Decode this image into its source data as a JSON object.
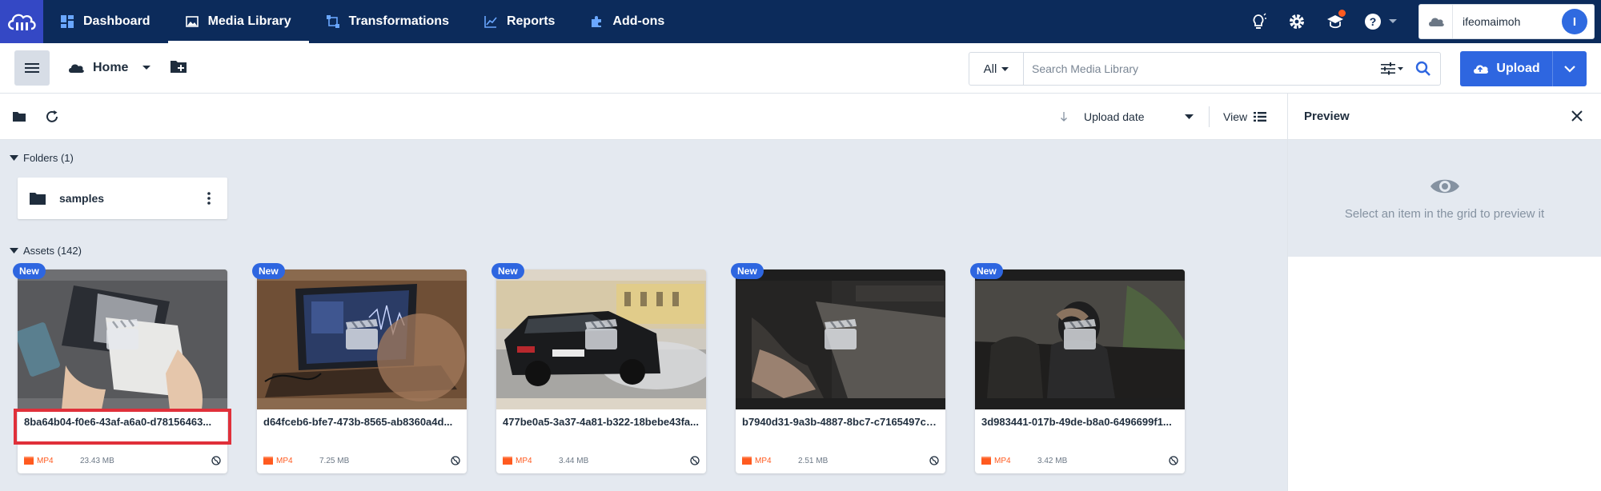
{
  "nav": {
    "items": [
      {
        "label": "Dashboard",
        "icon": "dashboard-icon"
      },
      {
        "label": "Media Library",
        "icon": "media-library-icon",
        "active": true
      },
      {
        "label": "Transformations",
        "icon": "transformations-icon"
      },
      {
        "label": "Reports",
        "icon": "reports-icon"
      },
      {
        "label": "Add-ons",
        "icon": "addons-icon"
      }
    ],
    "account_name": "ifeomaimoh",
    "avatar_initial": "I"
  },
  "toolbar": {
    "breadcrumb_home": "Home",
    "search_filter": "All",
    "search_placeholder": "Search Media Library",
    "upload_label": "Upload"
  },
  "subbar": {
    "sort_label": "Upload date",
    "view_label": "View"
  },
  "folders": {
    "header": "Folders (1)",
    "items": [
      {
        "name": "samples"
      }
    ]
  },
  "assets": {
    "header": "Assets (142)",
    "items": [
      {
        "badge": "New",
        "name": "8ba64b04-f0e6-43af-a6a0-d78156463...",
        "format": "MP4",
        "size": "23.43 MB",
        "selected_highlight": true
      },
      {
        "badge": "New",
        "name": "d64fceb6-bfe7-473b-8565-ab8360a4d...",
        "format": "MP4",
        "size": "7.25 MB"
      },
      {
        "badge": "New",
        "name": "477be0a5-3a37-4a81-b322-18bebe43fa...",
        "format": "MP4",
        "size": "3.44 MB"
      },
      {
        "badge": "New",
        "name": "b7940d31-9a3b-4887-8bc7-c7165497c3...",
        "format": "MP4",
        "size": "2.51 MB"
      },
      {
        "badge": "New",
        "name": "3d983441-017b-49de-b8a0-6496699f1...",
        "format": "MP4",
        "size": "3.42 MB"
      }
    ]
  },
  "preview": {
    "title": "Preview",
    "empty_message": "Select an item in the grid to preview it"
  },
  "colors": {
    "nav_bg": "#0c2b5b",
    "accent": "#2e66e0",
    "format_orange": "#ff5a1f",
    "highlight_red": "#e0303a"
  }
}
